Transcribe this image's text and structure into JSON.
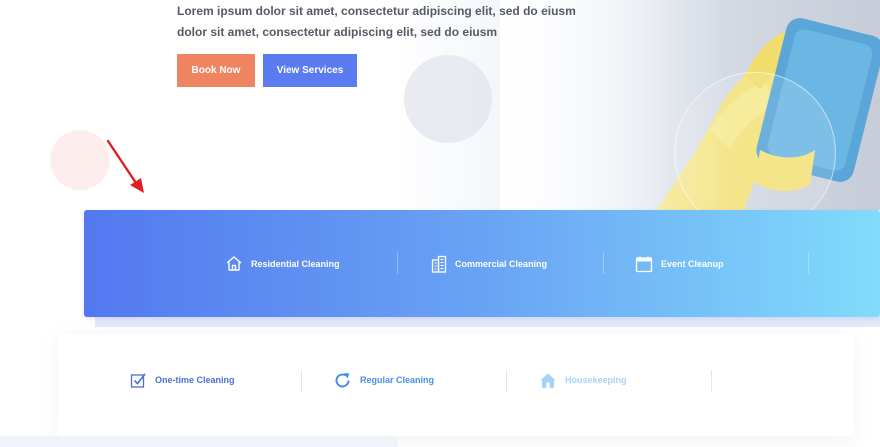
{
  "hero": {
    "line1": "Lorem ipsum dolor sit amet, consectetur adipiscing elit, sed do eiusm",
    "line2": "dolor sit amet, consectetur adipiscing elit, sed do eiusm",
    "book_label": "Book Now",
    "services_label": "View Services"
  },
  "services_band": {
    "items": [
      {
        "label": "Residential Cleaning",
        "icon": "house-icon"
      },
      {
        "label": "Commercial Cleaning",
        "icon": "building-icon"
      },
      {
        "label": "Event Cleanup",
        "icon": "calendar-icon"
      }
    ]
  },
  "service_types": {
    "items": [
      {
        "label": "One-time Cleaning",
        "icon": "checkbox-icon",
        "color": "#4a6fd6"
      },
      {
        "label": "Regular Cleaning",
        "icon": "refresh-icon",
        "color": "#4a8fe6"
      },
      {
        "label": "Housekeeping",
        "icon": "house-icon",
        "color": "#a6d3f7"
      }
    ]
  },
  "colors": {
    "book_button": "#ef8461",
    "services_button": "#5a7cf0",
    "band_start": "#5378ef",
    "band_end": "#81dbfb",
    "arrow": "#e02020"
  }
}
